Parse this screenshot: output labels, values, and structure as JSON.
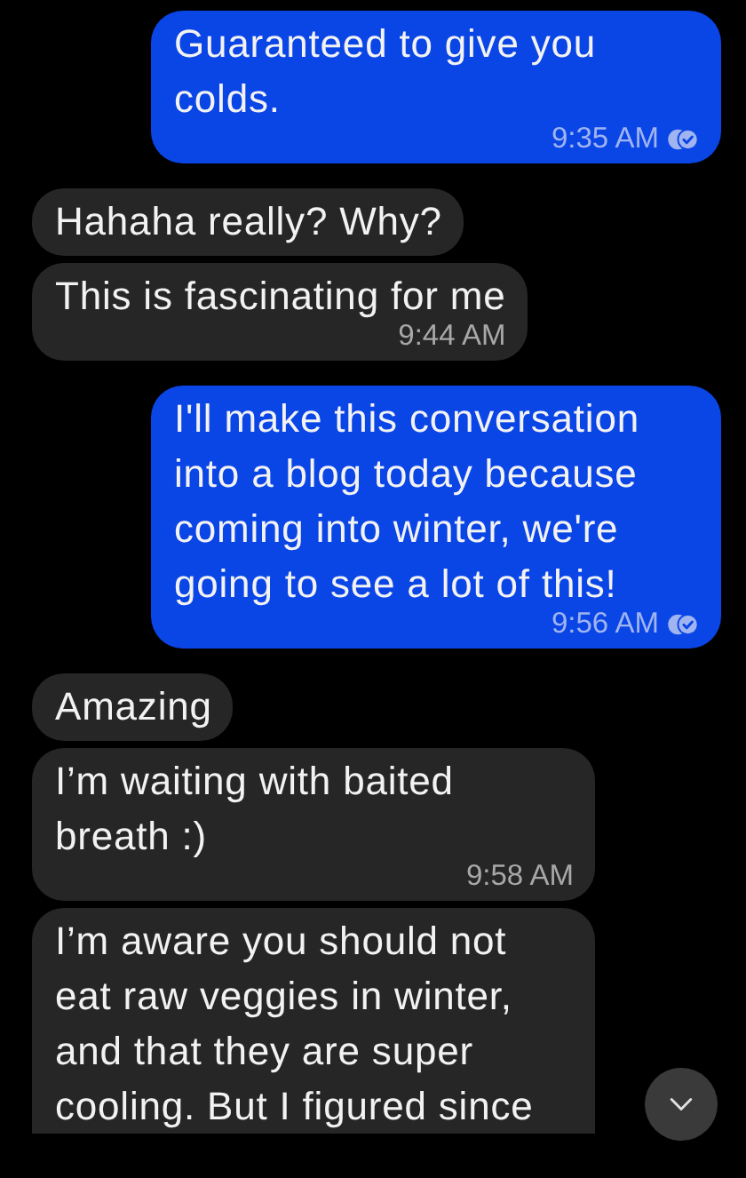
{
  "messages": [
    {
      "kind": "outgoing",
      "text": "Guaranteed to give you colds.",
      "time": "9:35 AM",
      "read": true
    },
    {
      "kind": "incoming",
      "text": "Hahaha really? Why?"
    },
    {
      "kind": "incoming",
      "text": "This is fascinating for me",
      "time": "9:44 AM"
    },
    {
      "kind": "outgoing",
      "text": "I'll make this conversation into a blog today because coming into winter, we're going to see a lot of this!",
      "time": "9:56 AM",
      "read": true
    },
    {
      "kind": "incoming",
      "text": "Amazing"
    },
    {
      "kind": "incoming",
      "text": "I’m waiting with baited breath :)",
      "time": "9:58 AM"
    },
    {
      "kind": "incoming",
      "text": "I’m aware you should not eat raw veggies in winter, and that they are super cooling. But I figured since"
    }
  ],
  "scroll_down_button": {
    "visible": true
  }
}
